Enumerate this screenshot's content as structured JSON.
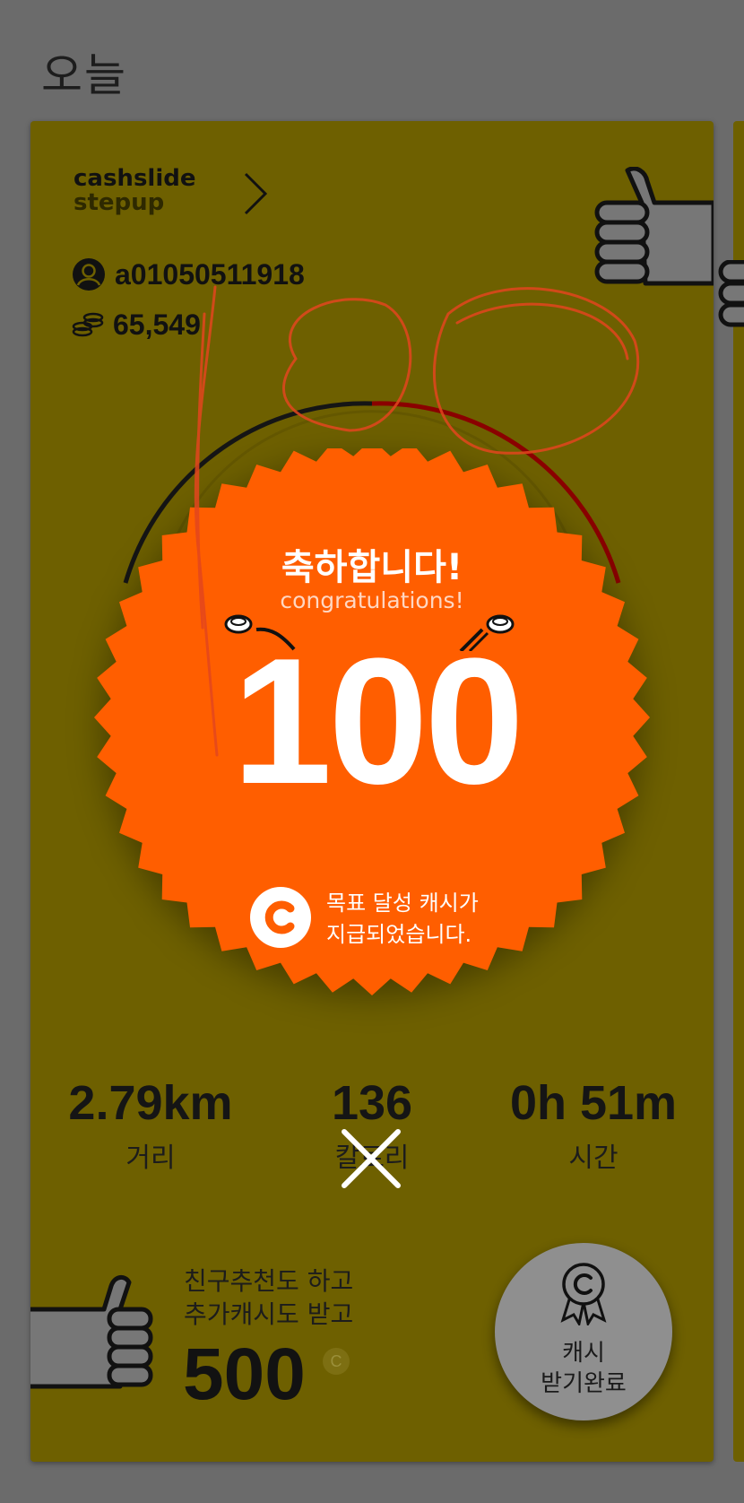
{
  "header": {
    "title": "오늘"
  },
  "brand": {
    "line1": "cashslide",
    "line2": "stepup"
  },
  "user": {
    "id": "a01050511918",
    "coins": "65,549"
  },
  "celebration": {
    "title_kr": "축하합니다!",
    "title_en": "congratulations!",
    "amount": "100",
    "message_line1": "목표 달성 캐시가",
    "message_line2": "지급되었습니다."
  },
  "stats": {
    "distance": {
      "value": "2.79km",
      "label": "거리"
    },
    "calories": {
      "value": "136",
      "label": "칼로리"
    },
    "time": {
      "value": "0h 51m",
      "label": "시간"
    }
  },
  "referral": {
    "line1": "친구추천도 하고",
    "line2": "추가캐시도 받고",
    "amount": "500"
  },
  "cash_button": {
    "line1": "캐시",
    "line2": "받기완료"
  },
  "colors": {
    "background": "#6b6b6b",
    "card": "#6e6000",
    "burst": "#ff5e00",
    "arc_progress": "#8a0000"
  }
}
